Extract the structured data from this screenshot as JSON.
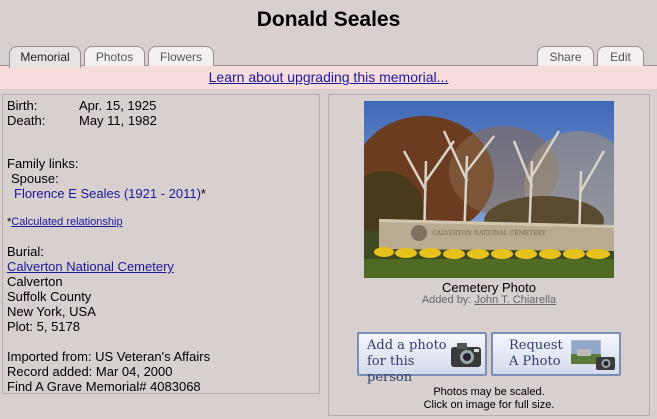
{
  "page": {
    "title": "Donald Seales"
  },
  "tabs": {
    "memorial": "Memorial",
    "photos": "Photos",
    "flowers": "Flowers",
    "share": "Share",
    "edit": "Edit"
  },
  "upgrade": {
    "text": "Learn about upgrading this memorial..."
  },
  "vitals": {
    "birth_label": "Birth:",
    "birth_value": "Apr. 15, 1925",
    "death_label": "Death:",
    "death_value": "May 11, 1982"
  },
  "family": {
    "heading": "Family links:",
    "spouse_label": "Spouse:",
    "spouse_name": "Florence E Seales (1921 - 2011)",
    "spouse_mark": "*",
    "calc_mark": "*",
    "calc_link": "Calculated relationship"
  },
  "burial": {
    "label": "Burial:",
    "cemetery": "Calverton National Cemetery",
    "city": "Calverton",
    "county": "Suffolk County",
    "state": "New York, USA",
    "plot": "Plot: 5, 5178"
  },
  "record": {
    "imported": "Imported from: US Veteran's Affairs",
    "added": "Record added: Mar 04, 2000",
    "memorial_id": "Find A Grave Memorial# 4083068"
  },
  "photo": {
    "caption": "Cemetery Photo",
    "added_by_label": "Added by:",
    "added_by_name": "John T. Chiarella",
    "note_line1": "Photos may be scaled.",
    "note_line2": "Click on image for full size."
  },
  "buttons": {
    "add_photo": "Add a photo\nfor this person",
    "request_photo": "Request\nA Photo"
  },
  "colors": {
    "background": "#d8cfcf",
    "upgrade_bar": "#f7dcdc",
    "link": "#1a1a99",
    "button_border": "#7a8fb8"
  }
}
